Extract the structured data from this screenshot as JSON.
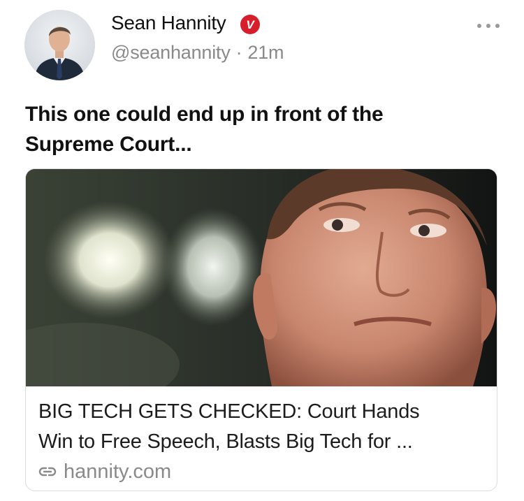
{
  "author": {
    "display_name": "Sean Hannity",
    "verified_badge_letter": "V",
    "handle": "@seanhannity",
    "separator": "·",
    "timestamp": "21m"
  },
  "tweet": {
    "text": "This one could end up in front of the Supreme Court..."
  },
  "link_card": {
    "title_line1": "BIG TECH GETS CHECKED: Court Hands",
    "title_line2": "Win to Free Speech, Blasts Big Tech for ...",
    "domain": "hannity.com"
  },
  "colors": {
    "text_primary": "#111111",
    "text_secondary": "#8a8a8a",
    "verified_badge": "#d81e2c",
    "card_border": "#dcdcdc"
  },
  "icons": {
    "more": "more-horizontal-icon",
    "link": "link-chain-icon",
    "verified": "verified-badge-icon"
  }
}
